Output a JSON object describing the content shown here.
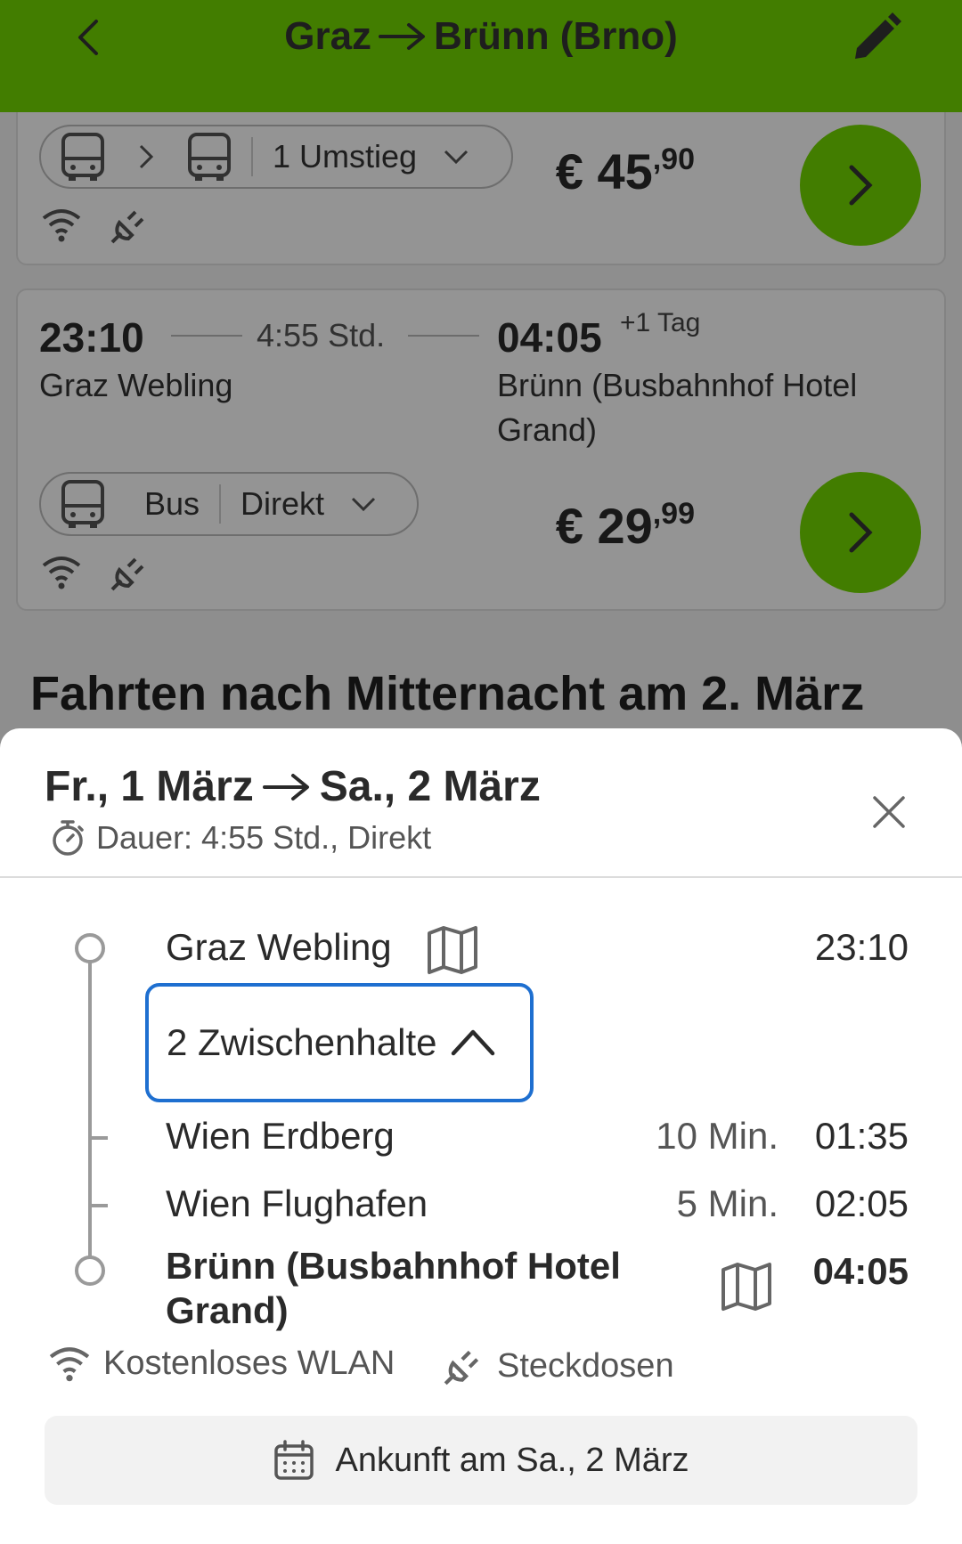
{
  "header": {
    "title_from": "Graz",
    "title_to": "Brünn (Brno)"
  },
  "card1": {
    "transfer_label": "1 Umstieg",
    "price_main": "€ 45",
    "price_cents": ",90"
  },
  "card2": {
    "dep_time": "23:10",
    "duration": "4:55 Std.",
    "arr_time": "04:05",
    "plus_day": "+1 Tag",
    "dep_station": "Graz Webling",
    "arr_station_line1": "Brünn (Busbahnhof Hotel",
    "arr_station_line2": "Grand)",
    "mode_label": "Bus",
    "connection_label": "Direkt",
    "price_main": "€ 29",
    "price_cents": ",99"
  },
  "section_title": "Fahrten nach Mitternacht am 2. März",
  "sheet": {
    "from_date": "Fr., 1 März",
    "to_date": "Sa., 2 März",
    "subtitle": "Dauer: 4:55 Std., Direkt",
    "stops_toggle": "2 Zwischenhalte",
    "stops": [
      {
        "name": "Graz Webling",
        "time": "23:10",
        "dwell": ""
      },
      {
        "name": "Wien Erdberg",
        "time": "01:35",
        "dwell": "10 Min."
      },
      {
        "name": "Wien Flughafen",
        "time": "02:05",
        "dwell": "5 Min."
      },
      {
        "name_line1": "Brünn (Busbahnhof Hotel",
        "name_line2": "Grand)",
        "time": "04:05"
      }
    ],
    "amenities": [
      "Kostenloses WLAN",
      "Steckdosen"
    ],
    "arrival_note": "Ankunft am Sa., 2 März"
  },
  "colors": {
    "brand_green": "#73d700",
    "focus_blue": "#1e6fd0"
  },
  "icons": [
    "back-icon",
    "edit-icon",
    "bus-icon",
    "chevron-right-icon",
    "chevron-down-icon",
    "wifi-icon",
    "plug-icon",
    "close-icon",
    "timer-icon",
    "map-icon",
    "chevron-up-icon",
    "calendar-icon"
  ]
}
